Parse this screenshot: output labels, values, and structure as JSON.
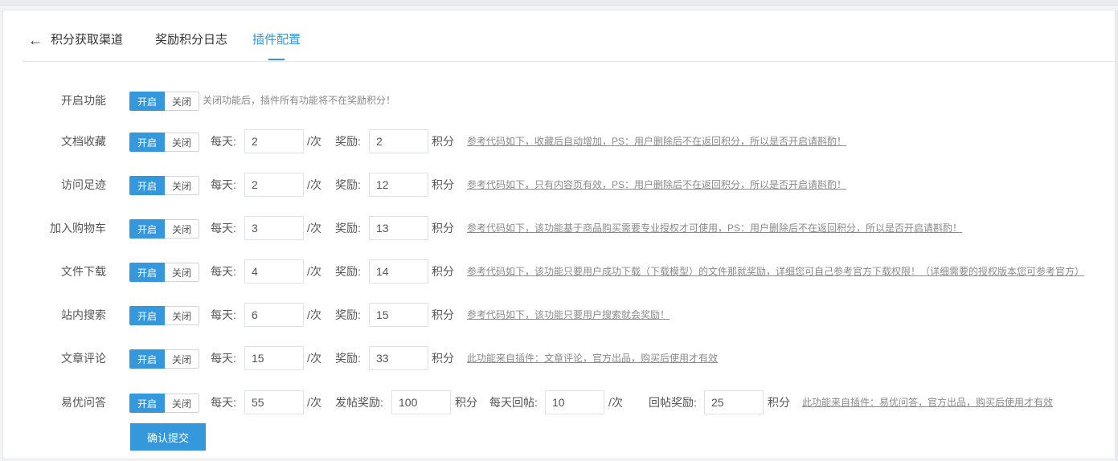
{
  "tabs": {
    "back_icon": "←",
    "items": [
      {
        "label": "积分获取渠道"
      },
      {
        "label": "奖励积分日志"
      },
      {
        "label": "插件配置"
      }
    ],
    "active": "插件配置"
  },
  "toggle": {
    "on_label": "开启",
    "off_label": "关闭"
  },
  "units": {
    "per_day": "每天:",
    "per_time": "/次",
    "reward": "奖励:",
    "points": "积分",
    "post_reward": "发帖奖励:",
    "daily_reply": "每天回帖:",
    "reply_reward": "回帖奖励:"
  },
  "master": {
    "label": "开启功能",
    "state": "开启",
    "hint": "关闭功能后，插件所有功能将不在奖励积分！"
  },
  "rows": [
    {
      "label": "文档收藏",
      "state": "开启",
      "per_day": "2",
      "reward": "2",
      "note": "参考代码如下，收藏后自动增加，PS：用户删除后不在返回积分，所以是否开启请斟酌！"
    },
    {
      "label": "访问足迹",
      "state": "开启",
      "per_day": "2",
      "reward": "12",
      "note": "参考代码如下，只有内容页有效，PS：用户删除后不在返回积分，所以是否开启请斟酌！"
    },
    {
      "label": "加入购物车",
      "state": "开启",
      "per_day": "3",
      "reward": "13",
      "note": "参考代码如下，该功能基于商品购买需要专业授权才可使用，PS：用户删除后不在返回积分，所以是否开启请斟酌！"
    },
    {
      "label": "文件下载",
      "state": "开启",
      "per_day": "4",
      "reward": "14",
      "note": "参考代码如下，该功能只要用户成功下载（下载模型）的文件那就奖励，详细您可自己参考官方下载权限！（详细需要的授权版本您可参考官方）"
    },
    {
      "label": "站内搜索",
      "state": "开启",
      "per_day": "6",
      "reward": "15",
      "note": "参考代码如下，该功能只要用户搜索就会奖励！"
    },
    {
      "label": "文章评论",
      "state": "开启",
      "per_day": "15",
      "reward": "33",
      "note": "此功能来自插件：文章评论，官方出品，购买后使用才有效"
    }
  ],
  "qa": {
    "label": "易优问答",
    "state": "开启",
    "per_day": "55",
    "post_reward": "100",
    "daily_reply": "10",
    "reply_reward": "25",
    "note": "此功能来自插件：易优问答，官方出品，购买后使用才有效"
  },
  "submit_label": "确认提交",
  "colors": {
    "accent": "#3598dc",
    "border": "#dfe2e6",
    "text": "#555555",
    "note": "#8a8a8a"
  }
}
